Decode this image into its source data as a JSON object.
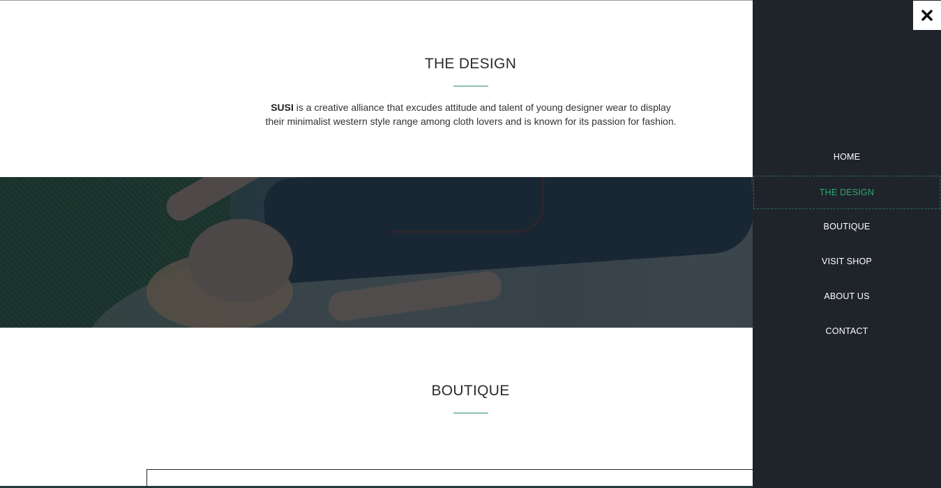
{
  "design_section": {
    "title": "THE DESIGN",
    "intro_brand": "SUSI",
    "intro_line1": " is a creative alliance that excudes attitude and talent of young designer wear to display",
    "intro_line2": "their minimalist western style range among cloth lovers and is known for its passion for fashion."
  },
  "boutique_section": {
    "title": "BOUTIQUE"
  },
  "sidenav": {
    "close_icon": "close-icon",
    "items": [
      {
        "label": "HOME"
      },
      {
        "label": "THE DESIGN",
        "active": true
      },
      {
        "label": "BOUTIQUE"
      },
      {
        "label": "VISIT SHOP"
      },
      {
        "label": "ABOUT US"
      },
      {
        "label": "CONTACT"
      }
    ],
    "active_color": "#2fa871",
    "background": "#1f242b"
  },
  "colors": {
    "accent": "#2a8a6a"
  }
}
